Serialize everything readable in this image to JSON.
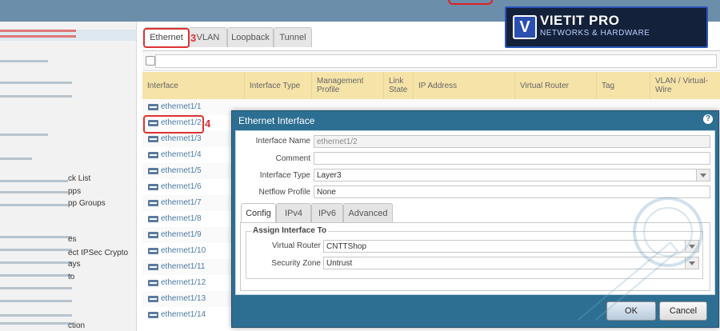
{
  "tabs": [
    {
      "label": "Ethernet"
    },
    {
      "label": "VLAN"
    },
    {
      "label": "Loopback"
    },
    {
      "label": "Tunnel"
    }
  ],
  "annotations": {
    "step3": "3",
    "step4": "4"
  },
  "sidebar": {
    "items": [
      "ck List",
      "pps",
      "pp Groups",
      "es",
      "ect IPSec Crypto",
      "ays",
      "to",
      "ction"
    ]
  },
  "grid": {
    "columns": [
      "Interface",
      "Interface Type",
      "Management Profile",
      "Link State",
      "IP Address",
      "Virtual Router",
      "Tag",
      "VLAN / Virtual-Wire"
    ],
    "rows": [
      "ethernet1/1",
      "ethernet1/2",
      "ethernet1/3",
      "ethernet1/4",
      "ethernet1/5",
      "ethernet1/6",
      "ethernet1/7",
      "ethernet1/8",
      "ethernet1/9",
      "ethernet1/10",
      "ethernet1/11",
      "ethernet1/12",
      "ethernet1/13",
      "ethernet1/14"
    ]
  },
  "dialog": {
    "title": "Ethernet Interface",
    "help_icon": "?",
    "fields": {
      "interface_name": {
        "label": "Interface Name",
        "value": "ethernet1/2"
      },
      "comment": {
        "label": "Comment",
        "value": ""
      },
      "interface_type": {
        "label": "Interface Type",
        "value": "Layer3"
      },
      "netflow_profile": {
        "label": "Netflow Profile",
        "value": "None"
      }
    },
    "subtabs": [
      {
        "label": "Config"
      },
      {
        "label": "IPv4"
      },
      {
        "label": "IPv6"
      },
      {
        "label": "Advanced"
      }
    ],
    "assign": {
      "legend": "Assign Interface To",
      "virtual_router": {
        "label": "Virtual Router",
        "value": "CNTTShop"
      },
      "security_zone": {
        "label": "Security Zone",
        "value": "Untrust"
      }
    },
    "buttons": {
      "ok": "OK",
      "cancel": "Cancel"
    }
  },
  "logo": {
    "name": "VIETIT PRO",
    "sub": "NETWORKS & HARDWARE",
    "mark": "V"
  },
  "colors": {
    "dialog_header": "#2d6f93",
    "grid_header": "#f6e3a8",
    "link": "#4b7aa8",
    "annotation": "#d33"
  }
}
